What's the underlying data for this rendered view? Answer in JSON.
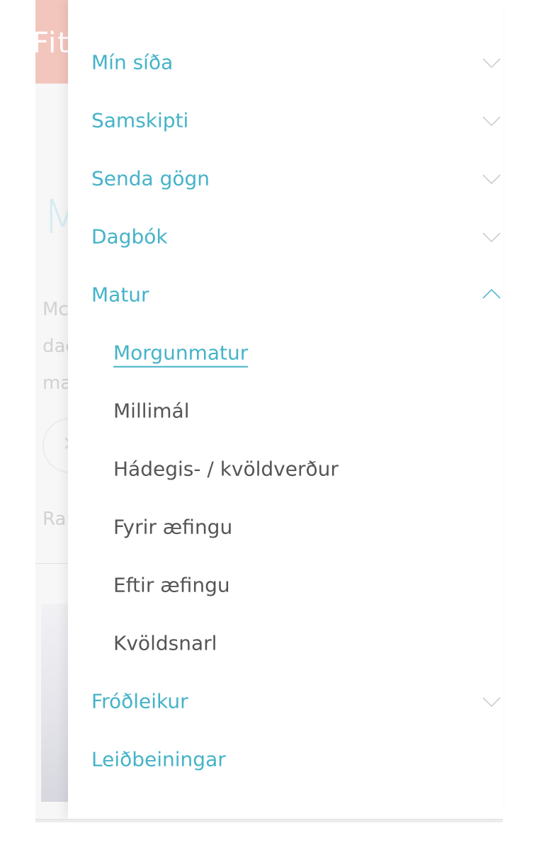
{
  "background_page": {
    "header_text": "Fit",
    "big_letter": "M",
    "text_lines": [
      "Mc",
      "dag",
      "ma"
    ],
    "footer_text": "Ra"
  },
  "colors": {
    "accent": "#45b3c8",
    "submenu_text": "#555555",
    "header_bg": "#f3c6bd"
  },
  "menu": {
    "items": [
      {
        "label": "Mín síða",
        "icon": "chevron-down-icon"
      },
      {
        "label": "Samskipti",
        "icon": "chevron-down-icon"
      },
      {
        "label": "Senda gögn",
        "icon": "chevron-down-icon"
      },
      {
        "label": "Dagbók",
        "icon": "chevron-down-icon"
      },
      {
        "label": "Matur",
        "icon": "chevron-up-icon",
        "expanded": true
      },
      {
        "label": "Fróðleikur",
        "icon": "chevron-down-icon"
      },
      {
        "label": "Leiðbeiningar"
      }
    ],
    "matur_subitems": [
      {
        "label": "Morgunmatur",
        "active": true
      },
      {
        "label": "Millimál"
      },
      {
        "label": "Hádegis- / kvöldverður"
      },
      {
        "label": "Fyrir æfingu"
      },
      {
        "label": "Eftir æfingu"
      },
      {
        "label": "Kvöldsnarl"
      }
    ]
  }
}
